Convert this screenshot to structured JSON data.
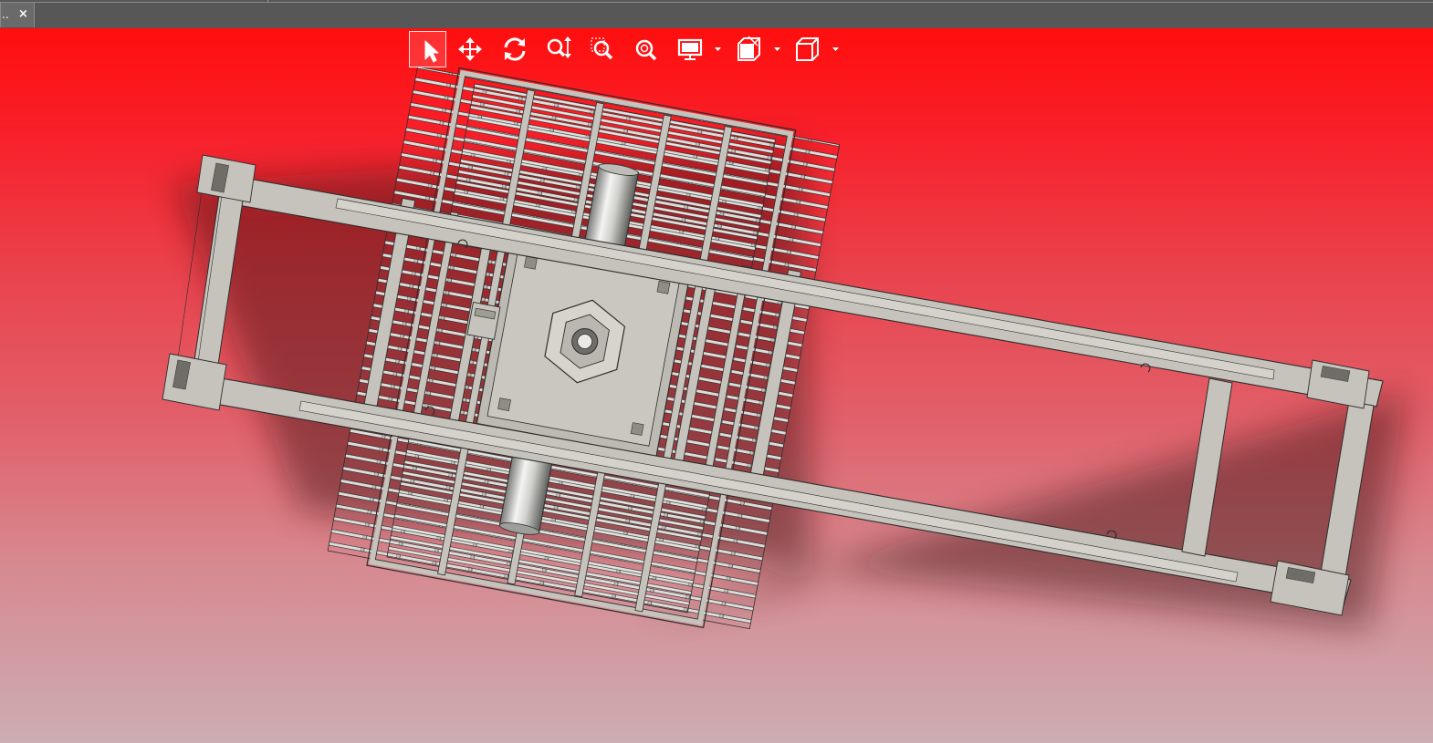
{
  "tab": {
    "label": "..",
    "close_glyph": "×"
  },
  "toolbar": {
    "tools": [
      {
        "name": "select-tool",
        "icon": "arrow-cursor-icon",
        "active": true
      },
      {
        "name": "pan-tool",
        "icon": "move-arrows-icon",
        "active": false
      },
      {
        "name": "rotate-tool",
        "icon": "rotate-icon",
        "active": false
      },
      {
        "name": "zoom-in-out-tool",
        "icon": "zoom-in-out-icon",
        "active": false
      },
      {
        "name": "zoom-to-area-tool",
        "icon": "zoom-area-icon",
        "active": false
      },
      {
        "name": "zoom-to-fit-tool",
        "icon": "zoom-fit-icon",
        "active": false
      },
      {
        "name": "display-style-dropdown",
        "icon": "monitor-icon",
        "has_dropdown": true
      },
      {
        "name": "section-view-dropdown",
        "icon": "section-view-icon",
        "has_dropdown": true
      },
      {
        "name": "view-orientation-dropdown",
        "icon": "cube-view-icon",
        "has_dropdown": true
      }
    ]
  },
  "viewport": {
    "background_top": "#ff0e0e",
    "background_bottom": "#ccadb3"
  },
  "model": {
    "body_color": "#c5c3bb",
    "edge_color": "#2d2d2d",
    "roller_color": "#d6d6d2"
  }
}
